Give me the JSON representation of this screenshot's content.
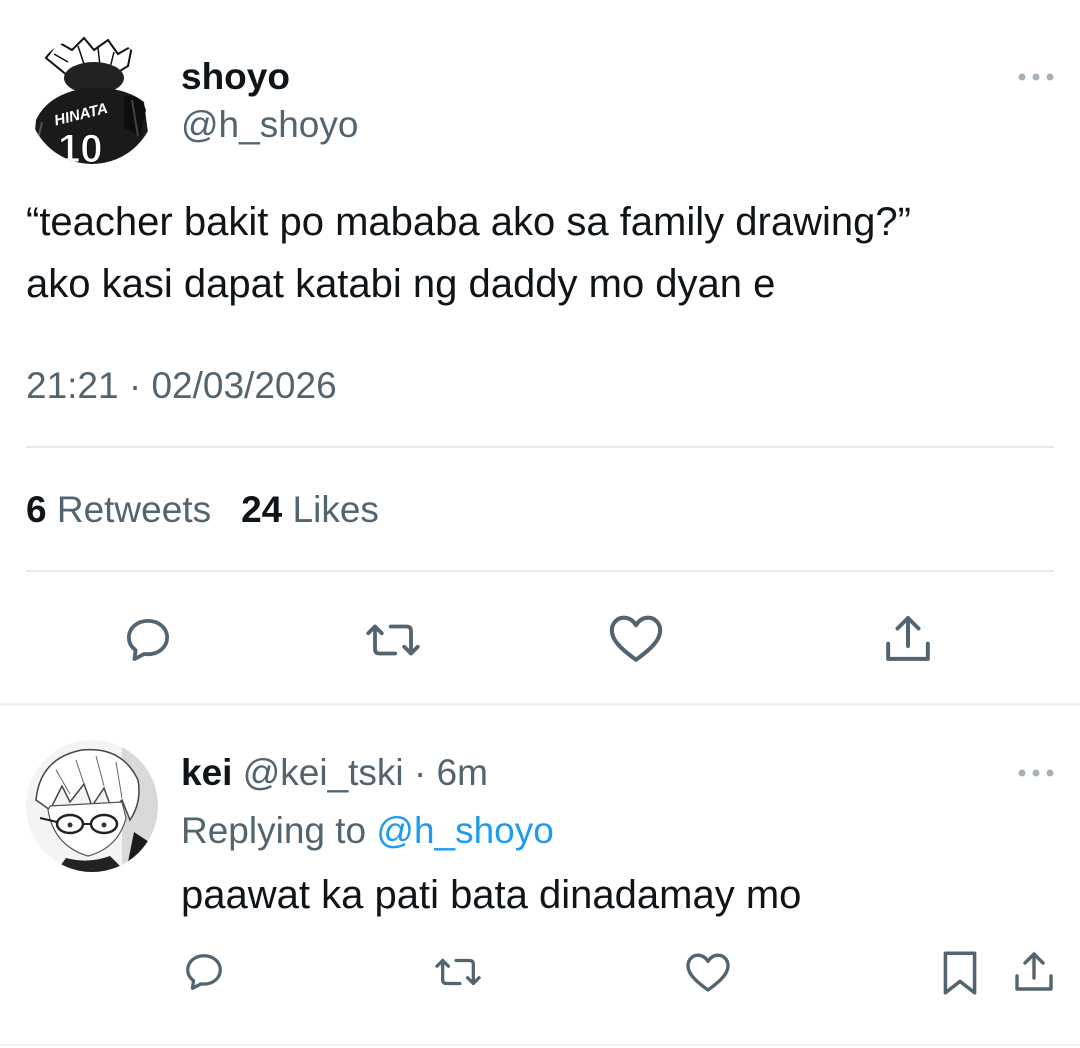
{
  "tweet": {
    "author": {
      "display_name": "shoyo",
      "handle": "@h_shoyo",
      "avatar_jersey_text": "HINATA",
      "avatar_jersey_number": "10"
    },
    "text_lines": [
      "“teacher bakit po mababa ako sa family drawing?”",
      "ako kasi dapat katabi ng daddy mo dyan e"
    ],
    "timestamp": "21:21 · 02/03/2026",
    "stats": {
      "retweets_count": "6",
      "retweets_label": "Retweets",
      "likes_count": "24",
      "likes_label": "Likes"
    },
    "actions": [
      "reply-icon",
      "retweet-icon",
      "like-icon",
      "share-icon"
    ],
    "more_icon": "more-horizontal-icon"
  },
  "reply": {
    "author": {
      "display_name": "kei",
      "handle": "@kei_tski",
      "time_ago": "6m"
    },
    "meta_separator": "·",
    "replying_to_label": "Replying to",
    "replying_to_handle": "@h_shoyo",
    "text": "paawat ka pati bata dinadamay mo",
    "actions": [
      "reply-icon",
      "retweet-icon",
      "like-icon",
      "bookmark-icon",
      "share-icon"
    ],
    "more_icon": "more-horizontal-icon"
  },
  "colors": {
    "text_primary": "#0f1419",
    "text_secondary": "#536471",
    "link": "#1d9bf0",
    "divider": "#e7e9ea",
    "icon": "#536471"
  }
}
